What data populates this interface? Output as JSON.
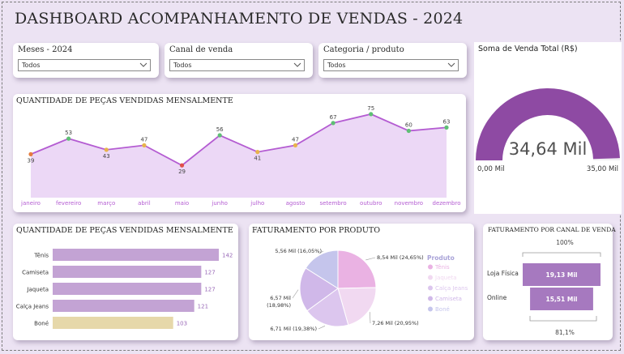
{
  "header": {
    "title": "DASHBOARD ACOMPANHAMENTO DE VENDAS - 2024"
  },
  "slicers": [
    {
      "label": "Meses - 2024",
      "value": "Todos"
    },
    {
      "label": "Canal de venda",
      "value": "Todos"
    },
    {
      "label": "Categoria / produto",
      "value": "Todos"
    }
  ],
  "kpi": {
    "title": "Soma de Venda Total (R$)",
    "value_label": "34,64 Mil",
    "min_label": "0,00 Mil",
    "max_label": "35,00 Mil",
    "value": 34.64,
    "max": 35.0,
    "color": "#8e4aa3",
    "track_color": "#f0eef2"
  },
  "line_card": {
    "title": "QUANTIDADE DE PEÇAS VENDIDAS MENSALMENTE"
  },
  "bar_card": {
    "title": "QUANTIDADE DE PEÇAS VENDIDAS MENSALMENTE"
  },
  "pie_card": {
    "title": "FATURAMENTO POR PRODUTO",
    "legend_title": "Produto"
  },
  "channel_card": {
    "title": "FATURAMENTO POR CANAL DE VENDA"
  },
  "chart_data": [
    {
      "type": "area",
      "categories": [
        "janeiro",
        "fevereiro",
        "março",
        "abril",
        "maio",
        "junho",
        "julho",
        "agosto",
        "setembro",
        "outubro",
        "novembro",
        "dezembro"
      ],
      "values": [
        39,
        53,
        43,
        47,
        29,
        56,
        41,
        47,
        67,
        75,
        60,
        63
      ],
      "marker_colors": [
        "#e57c3e",
        "#5fbf75",
        "#e7b34b",
        "#e7b34b",
        "#e0504a",
        "#5fbf75",
        "#e7b34b",
        "#e7b34b",
        "#5fbf75",
        "#5fbf75",
        "#5fbf75",
        "#5fbf75"
      ],
      "line_color": "#b45cd2",
      "fill_color": "#ecd8f6",
      "label_color": "#b45cd2"
    },
    {
      "type": "bar",
      "categories": [
        "Tênis",
        "Camiseta",
        "Jaqueta",
        "Calça Jeans",
        "Boné"
      ],
      "values": [
        142,
        127,
        127,
        121,
        103
      ],
      "bar_colors": [
        "#c3a3d4",
        "#c3a3d4",
        "#c3a3d4",
        "#c3a3d4",
        "#e6d8aa"
      ],
      "value_color": "#9a6ab8"
    },
    {
      "type": "pie",
      "legend_title": "Produto",
      "categories": [
        "Tênis",
        "Jaqueta",
        "Calça Jeans",
        "Camiseta",
        "Boné"
      ],
      "values": [
        8.54,
        7.26,
        6.71,
        6.57,
        5.56
      ],
      "value_labels": [
        "8,54 Mil (24,65%)",
        "7,26 Mil (20,95%)",
        "6,71 Mil (19,38%)",
        "6,57 Mil (18,98%)",
        "5,56 Mil (16,05%)"
      ],
      "colors": [
        "#eab2e3",
        "#f1d9f1",
        "#dcc6ee",
        "#d0b8e9",
        "#c5c5ec"
      ]
    },
    {
      "type": "bar",
      "categories": [
        "Loja Física",
        "Online"
      ],
      "values": [
        19.13,
        15.51
      ],
      "value_labels": [
        "19,13 Mil",
        "15,51 Mil"
      ],
      "top_label": "100%",
      "bottom_label": "81,1%",
      "bar_color": "#a679bf"
    }
  ]
}
